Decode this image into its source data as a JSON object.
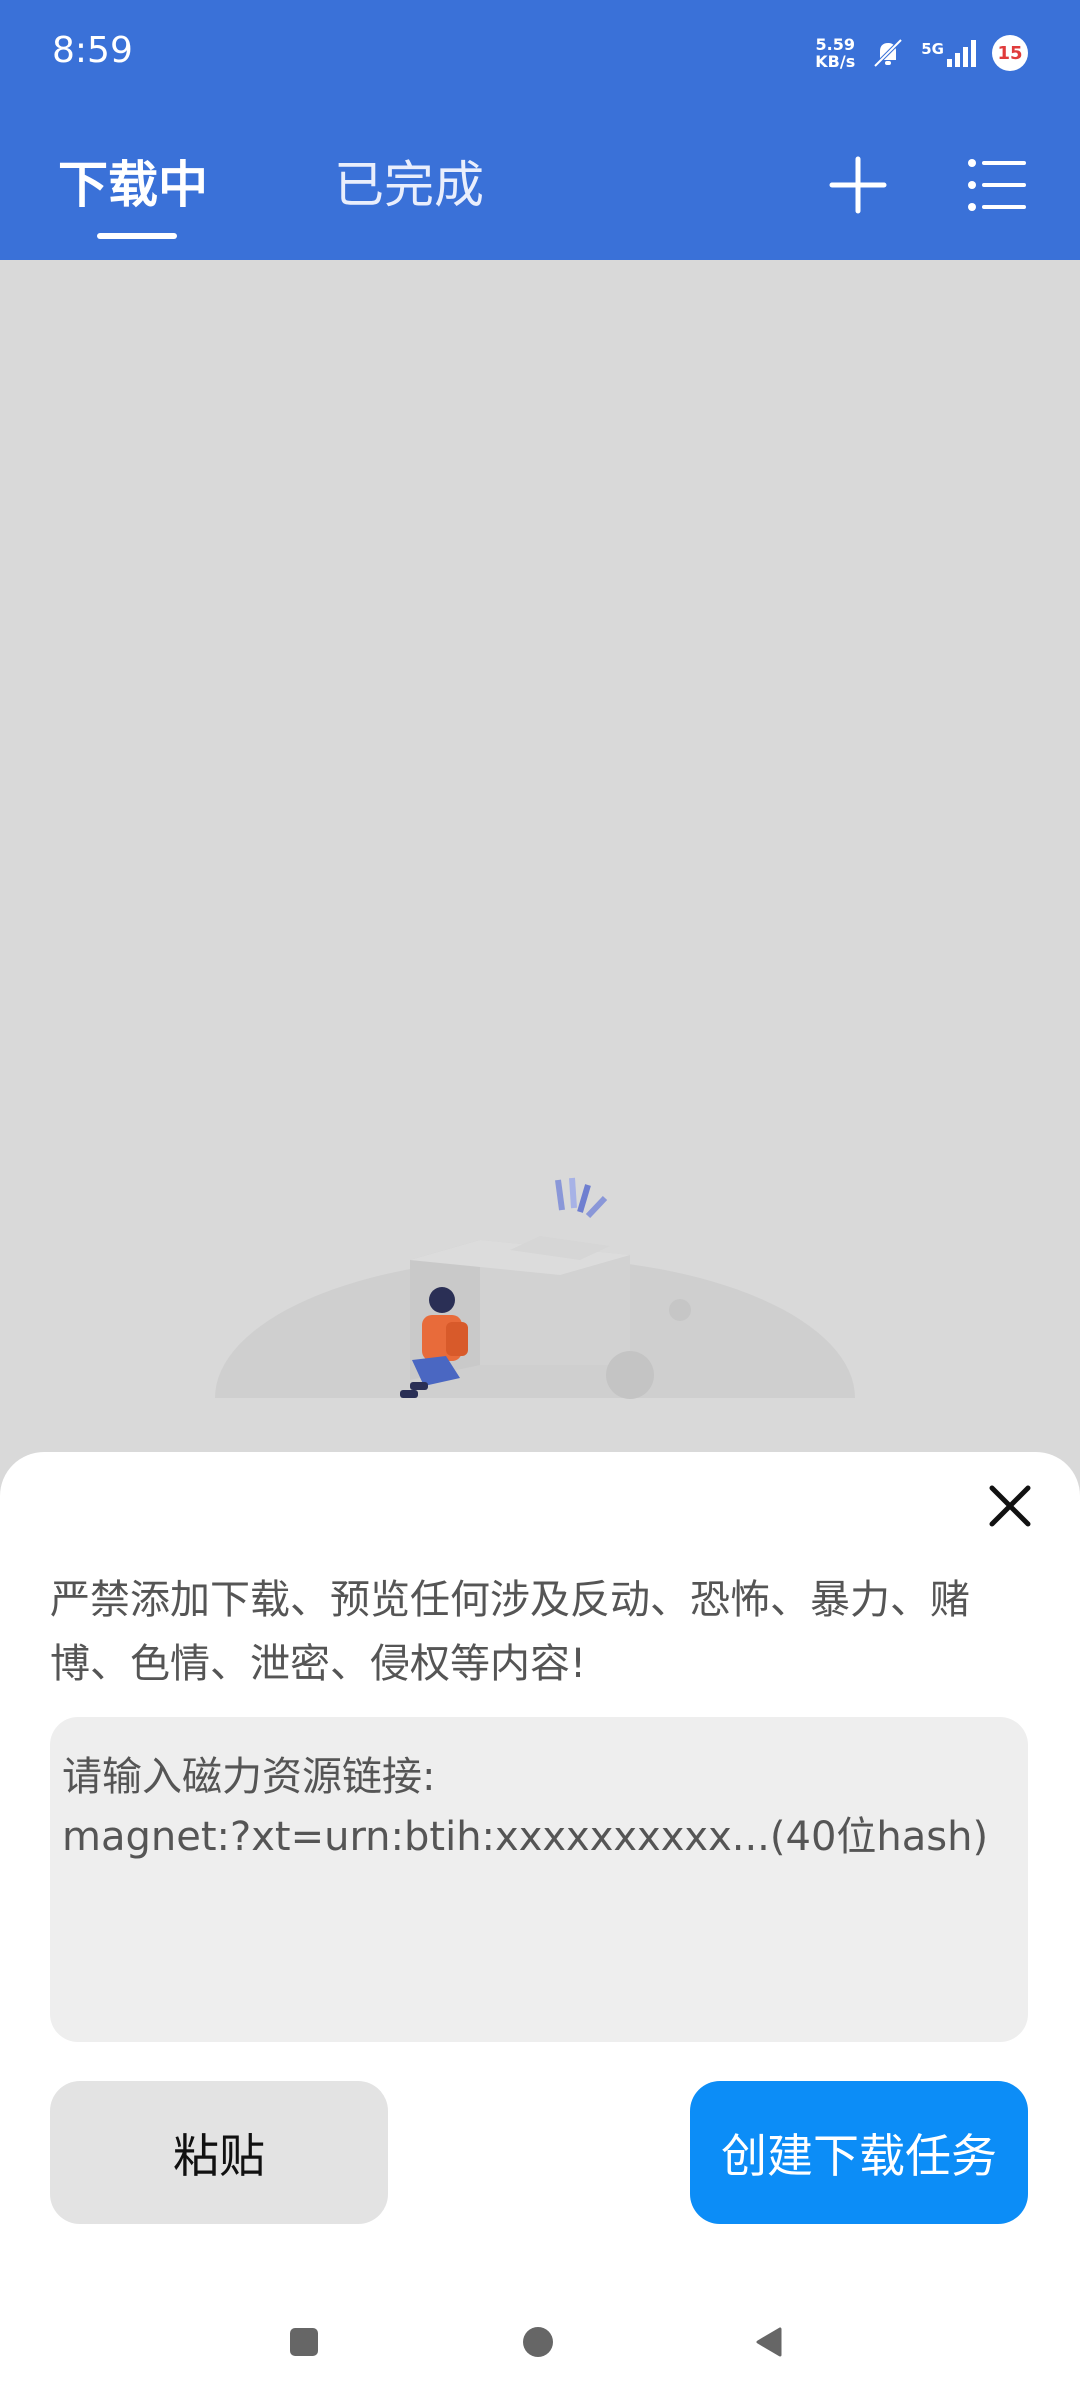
{
  "status": {
    "time": "8:59",
    "net_speed_value": "5.59",
    "net_speed_unit": "KB/s",
    "network": "5G",
    "notification_count": "15"
  },
  "tabs": [
    {
      "label": "下载中",
      "active": true
    },
    {
      "label": "已完成",
      "active": false
    }
  ],
  "sheet": {
    "notice": "严禁添加下载、预览任何涉及反动、恐怖、暴力、赌博、色情、泄密、侵权等内容!",
    "input_placeholder": "请输入磁力资源链接:\nmagnet:?xt=urn:btih:xxxxxxxxxx...(40位hash)",
    "paste_label": "粘贴",
    "create_label": "创建下载任务"
  },
  "colors": {
    "primary": "#3a71d8",
    "create_button": "#0c8df7",
    "content_bg": "#d9d9d9"
  }
}
